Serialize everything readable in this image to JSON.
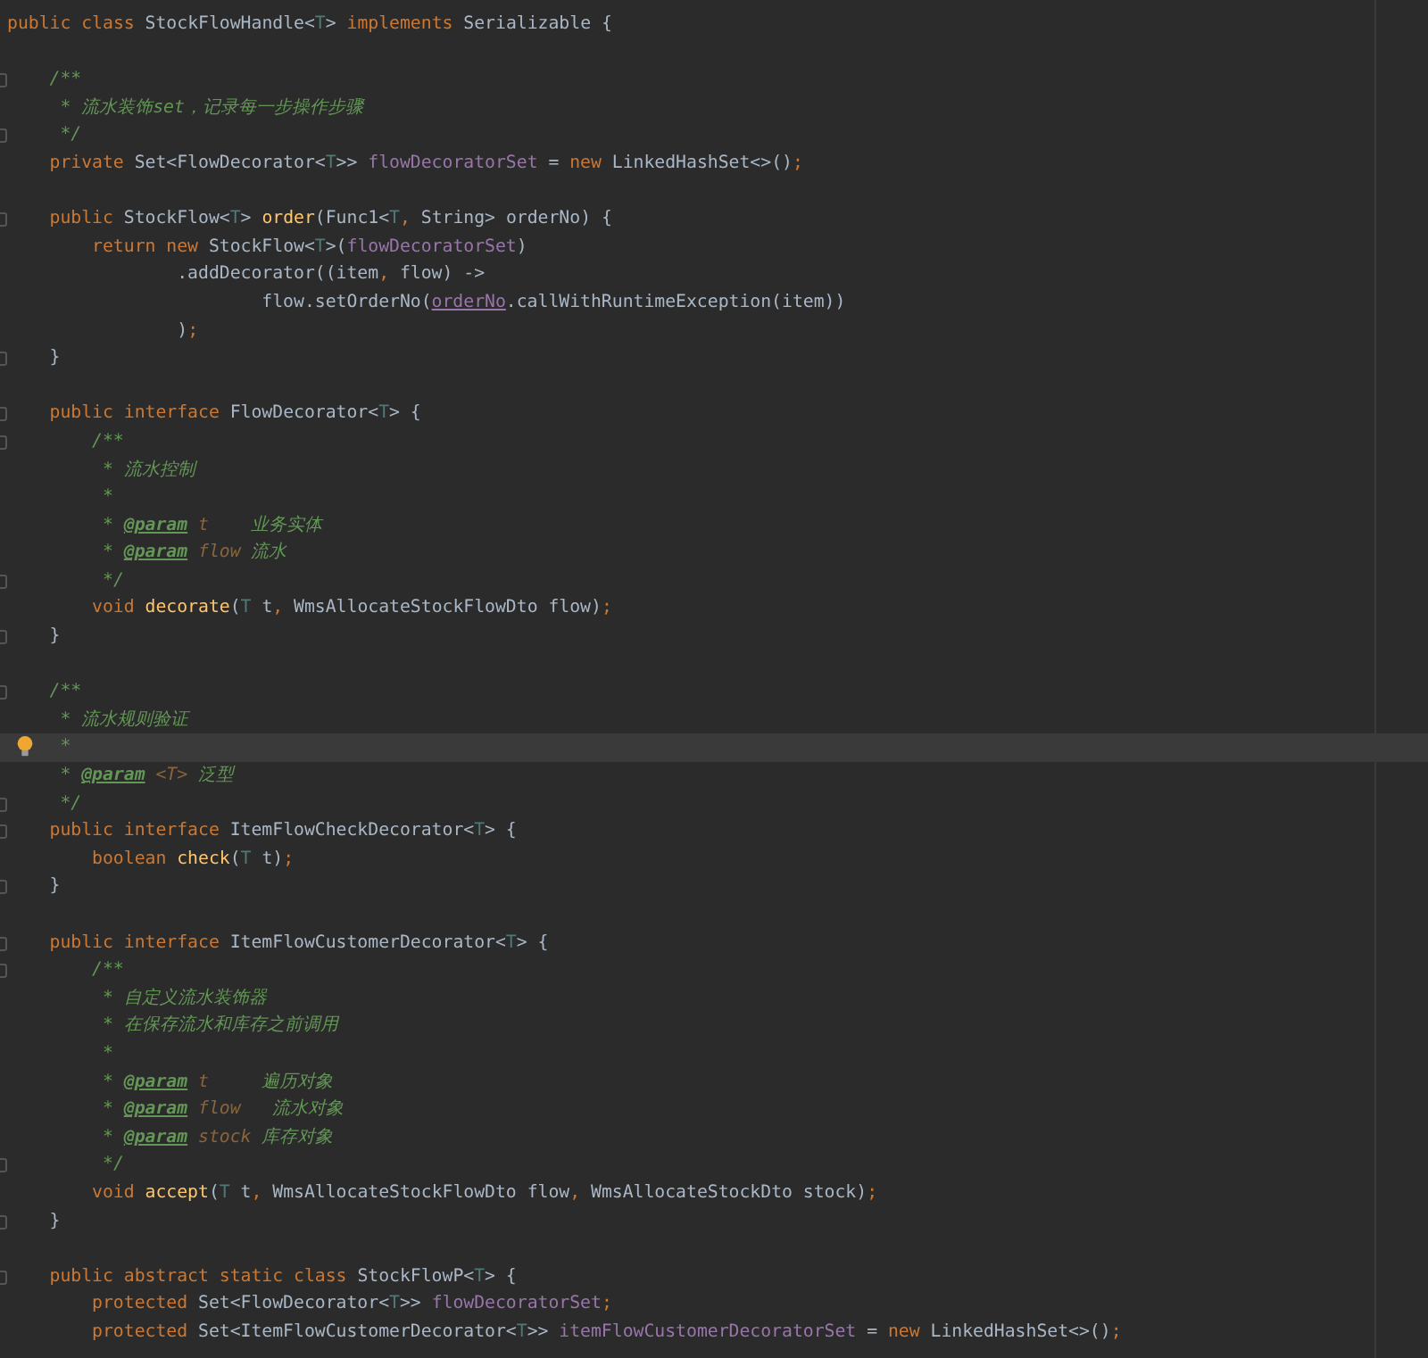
{
  "editor": {
    "lines": [
      {
        "current": false,
        "kind": "plain",
        "tokens": [
          {
            "kind": "kw",
            "text": "public class "
          },
          {
            "kind": "plain",
            "text": "StockFlowHandle<"
          },
          {
            "kind": "tp",
            "text": "T"
          },
          {
            "kind": "plain",
            "text": "> "
          },
          {
            "kind": "kw",
            "text": "implements "
          },
          {
            "kind": "plain",
            "text": "Serializable {"
          }
        ]
      },
      {
        "current": false,
        "kind": "plain"
      },
      {
        "current": false,
        "kind": "fold",
        "tokens": [
          {
            "kind": "cmt",
            "text": "    /**"
          }
        ]
      },
      {
        "current": false,
        "kind": "plain",
        "tokens": [
          {
            "kind": "cmt",
            "text": "     * 流水装饰set，记录每一步操作步骤"
          }
        ]
      },
      {
        "current": false,
        "kind": "fold",
        "tokens": [
          {
            "kind": "cmt",
            "text": "     */"
          }
        ]
      },
      {
        "current": false,
        "kind": "plain",
        "tokens": [
          {
            "kind": "kw",
            "text": "    private "
          },
          {
            "kind": "plain",
            "text": "Set<FlowDecorator<"
          },
          {
            "kind": "tp",
            "text": "T"
          },
          {
            "kind": "plain",
            "text": ">> "
          },
          {
            "kind": "field",
            "text": "flowDecoratorSet"
          },
          {
            "kind": "plain",
            "text": " = "
          },
          {
            "kind": "kw",
            "text": "new "
          },
          {
            "kind": "plain",
            "text": "LinkedHashSet<>()"
          },
          {
            "kind": "kw",
            "text": ";"
          }
        ]
      },
      {
        "current": false,
        "kind": "plain"
      },
      {
        "current": false,
        "kind": "fold",
        "tokens": [
          {
            "kind": "kw",
            "text": "    public "
          },
          {
            "kind": "plain",
            "text": "StockFlow<"
          },
          {
            "kind": "tp",
            "text": "T"
          },
          {
            "kind": "plain",
            "text": "> "
          },
          {
            "kind": "method",
            "text": "order"
          },
          {
            "kind": "plain",
            "text": "(Func1<"
          },
          {
            "kind": "tp",
            "text": "T"
          },
          {
            "kind": "kw",
            "text": ", "
          },
          {
            "kind": "plain",
            "text": "String> orderNo) {"
          }
        ]
      },
      {
        "current": false,
        "kind": "plain",
        "tokens": [
          {
            "kind": "kw",
            "text": "        return new "
          },
          {
            "kind": "plain",
            "text": "StockFlow<"
          },
          {
            "kind": "tp",
            "text": "T"
          },
          {
            "kind": "plain",
            "text": ">("
          },
          {
            "kind": "field",
            "text": "flowDecoratorSet"
          },
          {
            "kind": "plain",
            "text": ")"
          }
        ]
      },
      {
        "current": false,
        "kind": "plain",
        "tokens": [
          {
            "kind": "plain",
            "text": "                .addDecorator((item"
          },
          {
            "kind": "kw",
            "text": ", "
          },
          {
            "kind": "plain",
            "text": "flow) ->"
          }
        ]
      },
      {
        "current": false,
        "kind": "plain",
        "tokens": [
          {
            "kind": "plain",
            "text": "                        flow.setOrderNo("
          },
          {
            "kind": "fieldu",
            "text": "orderNo"
          },
          {
            "kind": "plain",
            "text": ".callWithRuntimeException(item))"
          }
        ]
      },
      {
        "current": false,
        "kind": "plain",
        "tokens": [
          {
            "kind": "plain",
            "text": "                )"
          },
          {
            "kind": "kw",
            "text": ";"
          }
        ]
      },
      {
        "current": false,
        "kind": "fold",
        "tokens": [
          {
            "kind": "plain",
            "text": "    }"
          }
        ]
      },
      {
        "current": false,
        "kind": "plain"
      },
      {
        "current": false,
        "kind": "fold",
        "tokens": [
          {
            "kind": "kw",
            "text": "    public interface "
          },
          {
            "kind": "plain",
            "text": "FlowDecorator<"
          },
          {
            "kind": "tp",
            "text": "T"
          },
          {
            "kind": "plain",
            "text": "> {"
          }
        ]
      },
      {
        "current": false,
        "kind": "fold",
        "tokens": [
          {
            "kind": "cmt",
            "text": "        /**"
          }
        ]
      },
      {
        "current": false,
        "kind": "plain",
        "tokens": [
          {
            "kind": "cmt",
            "text": "         * 流水控制"
          }
        ]
      },
      {
        "current": false,
        "kind": "plain",
        "tokens": [
          {
            "kind": "cmt",
            "text": "         *"
          }
        ]
      },
      {
        "current": false,
        "kind": "plain",
        "tokens": [
          {
            "kind": "cmt",
            "text": "         * "
          },
          {
            "kind": "tag",
            "text": "@param"
          },
          {
            "kind": "pname",
            "text": " t"
          },
          {
            "kind": "cmt",
            "text": "    业务实体"
          }
        ]
      },
      {
        "current": false,
        "kind": "plain",
        "tokens": [
          {
            "kind": "cmt",
            "text": "         * "
          },
          {
            "kind": "tag",
            "text": "@param"
          },
          {
            "kind": "pname",
            "text": " flow"
          },
          {
            "kind": "cmt",
            "text": " 流水"
          }
        ]
      },
      {
        "current": false,
        "kind": "fold",
        "tokens": [
          {
            "kind": "cmt",
            "text": "         */"
          }
        ]
      },
      {
        "current": false,
        "kind": "plain",
        "tokens": [
          {
            "kind": "kw",
            "text": "        void "
          },
          {
            "kind": "method",
            "text": "decorate"
          },
          {
            "kind": "plain",
            "text": "("
          },
          {
            "kind": "tp",
            "text": "T"
          },
          {
            "kind": "plain",
            "text": " t"
          },
          {
            "kind": "kw",
            "text": ", "
          },
          {
            "kind": "plain",
            "text": "WmsAllocateStockFlowDto flow)"
          },
          {
            "kind": "kw",
            "text": ";"
          }
        ]
      },
      {
        "current": false,
        "kind": "fold",
        "tokens": [
          {
            "kind": "plain",
            "text": "    }"
          }
        ]
      },
      {
        "current": false,
        "kind": "plain"
      },
      {
        "current": false,
        "kind": "fold",
        "tokens": [
          {
            "kind": "cmt",
            "text": "    /**"
          }
        ]
      },
      {
        "current": false,
        "kind": "plain",
        "tokens": [
          {
            "kind": "cmt",
            "text": "     * 流水规则验证"
          }
        ]
      },
      {
        "current": true,
        "kind": "bulb",
        "tokens": [
          {
            "kind": "cmt",
            "text": "     *"
          }
        ]
      },
      {
        "current": false,
        "kind": "plain",
        "tokens": [
          {
            "kind": "cmt",
            "text": "     * "
          },
          {
            "kind": "tag",
            "text": "@param"
          },
          {
            "kind": "pname",
            "text": " <T>"
          },
          {
            "kind": "cmt",
            "text": " 泛型"
          }
        ]
      },
      {
        "current": false,
        "kind": "fold",
        "tokens": [
          {
            "kind": "cmt",
            "text": "     */"
          }
        ]
      },
      {
        "current": false,
        "kind": "fold",
        "tokens": [
          {
            "kind": "kw",
            "text": "    public interface "
          },
          {
            "kind": "plain",
            "text": "ItemFlowCheckDecorator<"
          },
          {
            "kind": "tp",
            "text": "T"
          },
          {
            "kind": "plain",
            "text": "> {"
          }
        ]
      },
      {
        "current": false,
        "kind": "plain",
        "tokens": [
          {
            "kind": "kw",
            "text": "        boolean "
          },
          {
            "kind": "method",
            "text": "check"
          },
          {
            "kind": "plain",
            "text": "("
          },
          {
            "kind": "tp",
            "text": "T"
          },
          {
            "kind": "plain",
            "text": " t)"
          },
          {
            "kind": "kw",
            "text": ";"
          }
        ]
      },
      {
        "current": false,
        "kind": "fold",
        "tokens": [
          {
            "kind": "plain",
            "text": "    }"
          }
        ]
      },
      {
        "current": false,
        "kind": "plain"
      },
      {
        "current": false,
        "kind": "fold",
        "tokens": [
          {
            "kind": "kw",
            "text": "    public interface "
          },
          {
            "kind": "plain",
            "text": "ItemFlowCustomerDecorator<"
          },
          {
            "kind": "tp",
            "text": "T"
          },
          {
            "kind": "plain",
            "text": "> {"
          }
        ]
      },
      {
        "current": false,
        "kind": "fold",
        "tokens": [
          {
            "kind": "cmt",
            "text": "        /**"
          }
        ]
      },
      {
        "current": false,
        "kind": "plain",
        "tokens": [
          {
            "kind": "cmt",
            "text": "         * 自定义流水装饰器"
          }
        ]
      },
      {
        "current": false,
        "kind": "plain",
        "tokens": [
          {
            "kind": "cmt",
            "text": "         * 在保存流水和库存之前调用"
          }
        ]
      },
      {
        "current": false,
        "kind": "plain",
        "tokens": [
          {
            "kind": "cmt",
            "text": "         *"
          }
        ]
      },
      {
        "current": false,
        "kind": "plain",
        "tokens": [
          {
            "kind": "cmt",
            "text": "         * "
          },
          {
            "kind": "tag",
            "text": "@param"
          },
          {
            "kind": "pname",
            "text": " t"
          },
          {
            "kind": "cmt",
            "text": "     遍历对象"
          }
        ]
      },
      {
        "current": false,
        "kind": "plain",
        "tokens": [
          {
            "kind": "cmt",
            "text": "         * "
          },
          {
            "kind": "tag",
            "text": "@param"
          },
          {
            "kind": "pname",
            "text": " flow"
          },
          {
            "kind": "cmt",
            "text": "   流水对象"
          }
        ]
      },
      {
        "current": false,
        "kind": "plain",
        "tokens": [
          {
            "kind": "cmt",
            "text": "         * "
          },
          {
            "kind": "tag",
            "text": "@param"
          },
          {
            "kind": "pname",
            "text": " stock"
          },
          {
            "kind": "cmt",
            "text": " 库存对象"
          }
        ]
      },
      {
        "current": false,
        "kind": "fold",
        "tokens": [
          {
            "kind": "cmt",
            "text": "         */"
          }
        ]
      },
      {
        "current": false,
        "kind": "plain",
        "tokens": [
          {
            "kind": "kw",
            "text": "        void "
          },
          {
            "kind": "method",
            "text": "accept"
          },
          {
            "kind": "plain",
            "text": "("
          },
          {
            "kind": "tp",
            "text": "T"
          },
          {
            "kind": "plain",
            "text": " t"
          },
          {
            "kind": "kw",
            "text": ", "
          },
          {
            "kind": "plain",
            "text": "WmsAllocateStockFlowDto flow"
          },
          {
            "kind": "kw",
            "text": ", "
          },
          {
            "kind": "plain",
            "text": "WmsAllocateStockDto stock)"
          },
          {
            "kind": "kw",
            "text": ";"
          }
        ]
      },
      {
        "current": false,
        "kind": "fold",
        "tokens": [
          {
            "kind": "plain",
            "text": "    }"
          }
        ]
      },
      {
        "current": false,
        "kind": "plain"
      },
      {
        "current": false,
        "kind": "fold",
        "tokens": [
          {
            "kind": "kw",
            "text": "    public abstract static class "
          },
          {
            "kind": "plain",
            "text": "StockFlowP<"
          },
          {
            "kind": "tp",
            "text": "T"
          },
          {
            "kind": "plain",
            "text": "> {"
          }
        ]
      },
      {
        "current": false,
        "kind": "plain",
        "tokens": [
          {
            "kind": "kw",
            "text": "        protected "
          },
          {
            "kind": "plain",
            "text": "Set<FlowDecorator<"
          },
          {
            "kind": "tp",
            "text": "T"
          },
          {
            "kind": "plain",
            "text": ">> "
          },
          {
            "kind": "field",
            "text": "flowDecoratorSet"
          },
          {
            "kind": "kw",
            "text": ";"
          }
        ]
      },
      {
        "current": false,
        "kind": "plain",
        "tokens": [
          {
            "kind": "kw",
            "text": "        protected "
          },
          {
            "kind": "plain",
            "text": "Set<ItemFlowCustomerDecorator<"
          },
          {
            "kind": "tp",
            "text": "T"
          },
          {
            "kind": "plain",
            "text": ">> "
          },
          {
            "kind": "field",
            "text": "itemFlowCustomerDecoratorSet"
          },
          {
            "kind": "plain",
            "text": " = "
          },
          {
            "kind": "kw",
            "text": "new "
          },
          {
            "kind": "plain",
            "text": "LinkedHashSet<>()"
          },
          {
            "kind": "kw",
            "text": ";"
          }
        ]
      }
    ]
  }
}
